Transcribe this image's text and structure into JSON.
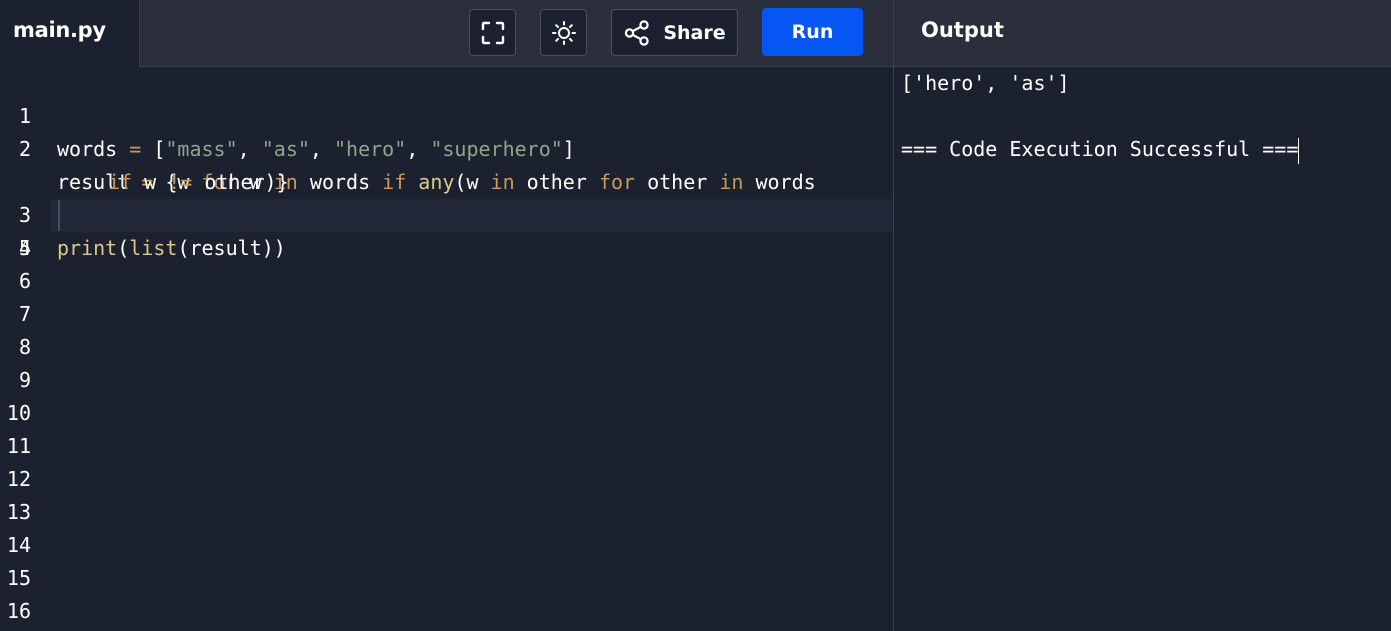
{
  "header": {
    "file_name": "main.py",
    "fullscreen_icon": "fullscreen-icon",
    "theme_icon": "sun-icon",
    "share_label": "Share",
    "run_label": "Run",
    "output_title": "Output"
  },
  "colors": {
    "topbar": "#2b2f3c",
    "background": "#1c2130",
    "run_button": "#0556f3",
    "keyword": "#c99a5b",
    "string": "#8fa58a",
    "builtin": "#dbc989"
  },
  "editor": {
    "line_numbers": [
      "1",
      "2",
      "3",
      "4",
      "5",
      "6",
      "7",
      "8",
      "9",
      "10",
      "11",
      "12",
      "13",
      "14",
      "15",
      "16"
    ],
    "lines": [
      "words = [\"mass\", \"as\", \"hero\", \"superhero\"]",
      "result = {w for w in words if any(w in other for other in words",
      "if w != other)}",
      "print(list(result))",
      ""
    ],
    "active_line": 4
  },
  "output": {
    "lines": [
      "['hero', 'as']",
      "",
      "=== Code Execution Successful ==="
    ]
  }
}
